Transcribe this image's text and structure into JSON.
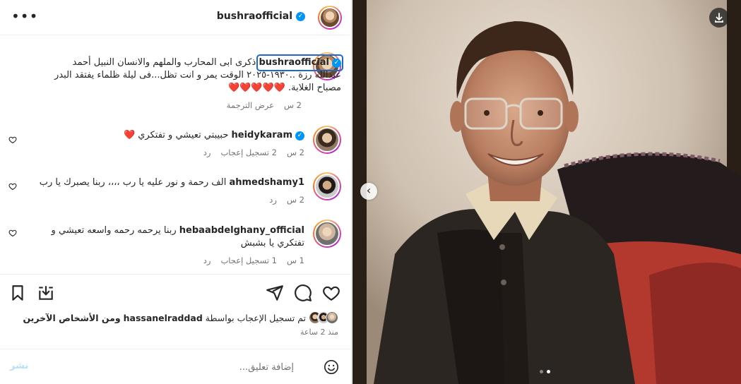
{
  "header": {
    "username": "bushraofficial",
    "more_label": "•••"
  },
  "caption": {
    "username": "bushraofficial",
    "text": "ذكرى ابى المحارب والملهم والانسان النبيل أحمد عبدالله رزة ..١٩٣٠-٢٠٢٥ الوقت يمر و انت تظل...فى ليلة ظلماء يفتقد البدر مصباح الغلابة.",
    "hearts": "❤️❤️❤️❤️❤️",
    "time": "2 س",
    "see_translation": "عرض الترجمة"
  },
  "comments": [
    {
      "username": "heidykaram",
      "verified": true,
      "text": "حبيبتي تعيشي و تفتكري ❤️",
      "time": "2 س",
      "likes": "2 تسجيل إعجاب",
      "reply": "رد"
    },
    {
      "username": "ahmedshamy1",
      "verified": false,
      "text": "الف رحمة و نور عليه يا رب ،،،، ربنا يصبرك يا رب",
      "time": "2 س",
      "reply": "رد"
    },
    {
      "username": "hebaabdelghany_official",
      "verified": false,
      "text": "ربنا يرحمه رحمه واسعه تعيشي و تفتكري يا بشبش",
      "time": "1 س",
      "likes": "1 تسجيل إعجاب",
      "reply": "رد"
    }
  ],
  "likes": {
    "prefix": "تم تسجيل الإعجاب بواسطة",
    "user": "hassanelraddad",
    "suffix": "ومن الأشخاص الآخرين"
  },
  "time_ago": "منذ 2 ساعة",
  "add_comment": {
    "placeholder": "إضافة تعليق...",
    "post_label": "نشر"
  },
  "carousel": {
    "current": 2,
    "total": 2
  },
  "icons": {
    "like": "heart-icon",
    "comment": "comment-icon",
    "share": "send-icon",
    "save": "bookmark-icon",
    "download": "download-icon",
    "emoji": "emoji-icon"
  }
}
